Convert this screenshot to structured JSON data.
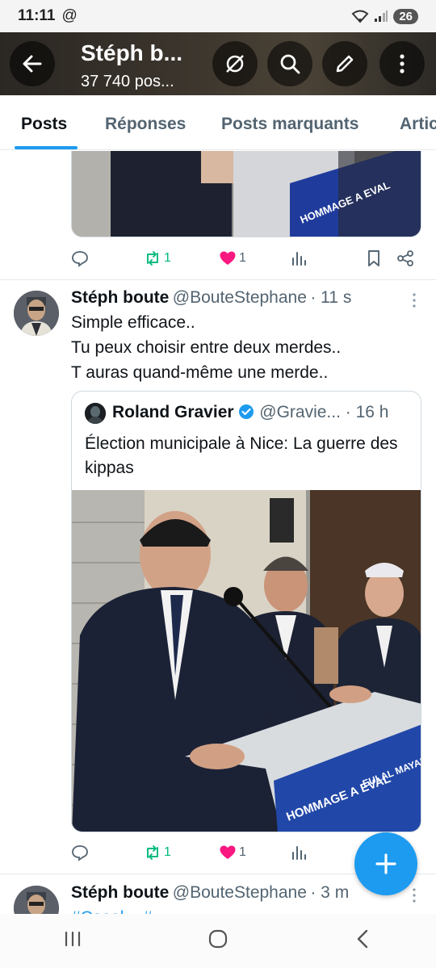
{
  "status_bar": {
    "time": "11:11",
    "at_icon": "@",
    "battery": "26"
  },
  "header": {
    "title": "Stéph b...",
    "subtitle": "37 740 pos..."
  },
  "tabs": [
    {
      "label": "Posts"
    },
    {
      "label": "Réponses"
    },
    {
      "label": "Posts marquants"
    },
    {
      "label": "Artic"
    }
  ],
  "posts": [
    {
      "repost_count": "1",
      "like_count": "1"
    },
    {
      "author_name": "Stéph boute",
      "author_handle": "@BouteStephane",
      "time": "· 11 s",
      "text_lines": [
        "Simple efficace..",
        "Tu peux choisir entre deux merdes..",
        "T auras quand-même une merde.."
      ],
      "quote": {
        "author_name": "Roland Gravier",
        "author_handle": "@Gravie...",
        "time": "· 16 h",
        "text": "Élection municipale à Nice: La guerre des kippas",
        "banner_text": "HOMMAGE A EVAL",
        "banner_small": "EULAL MAYAL"
      },
      "repost_count": "1",
      "like_count": "1"
    },
    {
      "author_name": "Stéph boute",
      "author_handle": "@BouteStephane",
      "time": "· 3 m",
      "text_partial": "#Casel... #..."
    }
  ],
  "top_banner_text": "HOMMAGE A EVAL",
  "colors": {
    "accent": "#1d9bf0",
    "repost": "#00ba7c",
    "like": "#f91880",
    "muted": "#536471"
  }
}
